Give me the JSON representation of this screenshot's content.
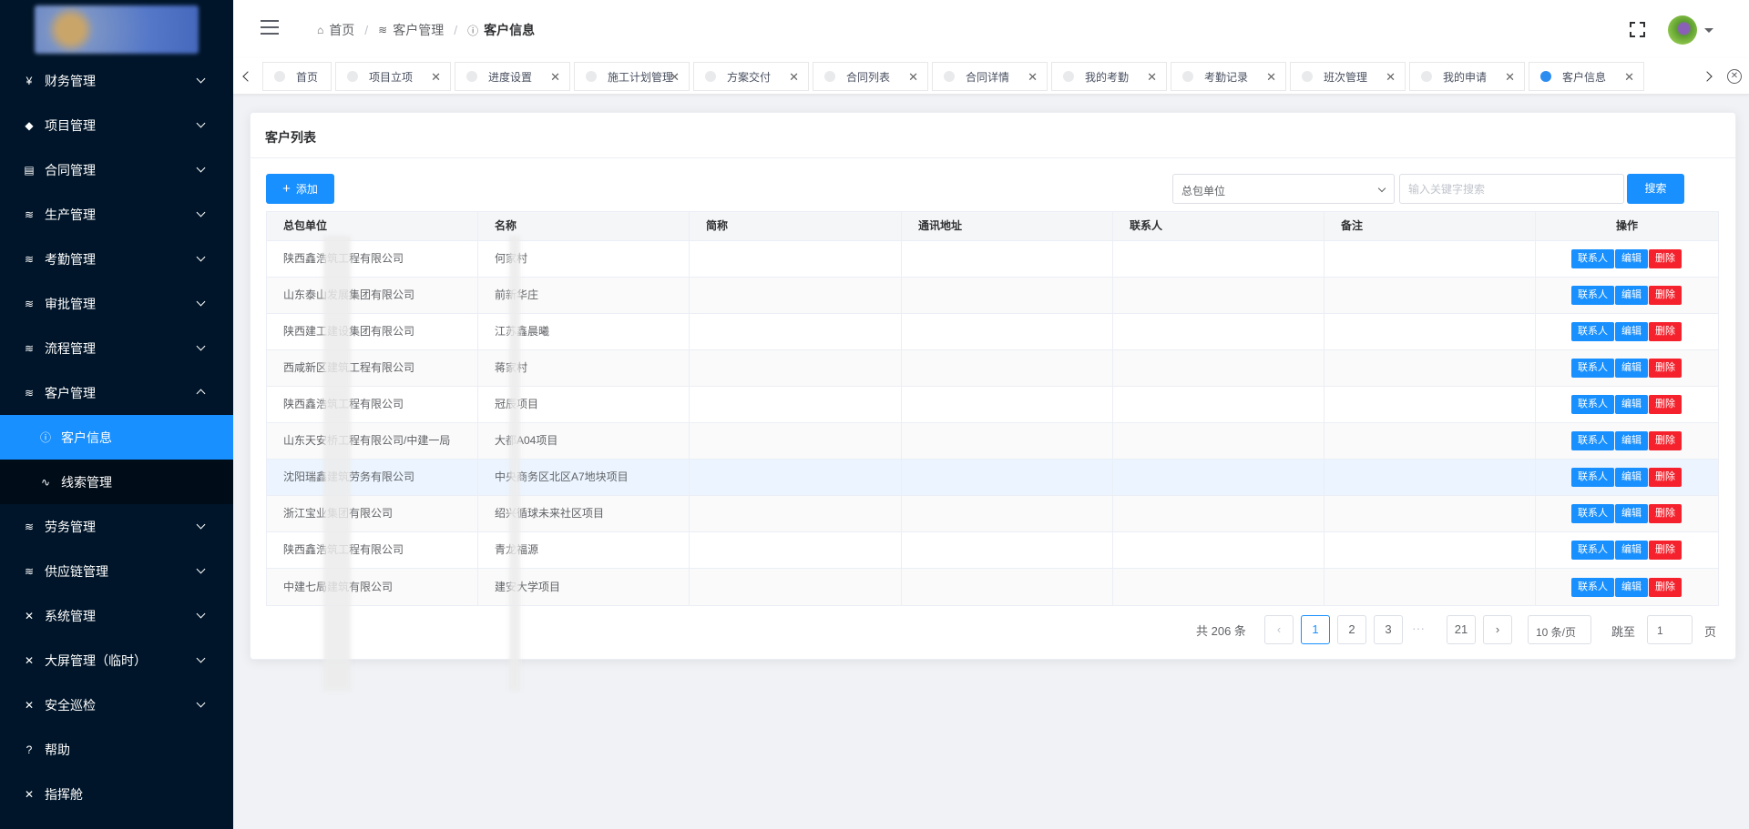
{
  "sidebar": {
    "items": [
      {
        "icon": "¥",
        "label": "财务管理",
        "expanded": false
      },
      {
        "icon": "◆",
        "label": "项目管理",
        "expanded": false
      },
      {
        "icon": "▤",
        "label": "合同管理",
        "expanded": false
      },
      {
        "icon": "≋",
        "label": "生产管理",
        "expanded": false
      },
      {
        "icon": "≋",
        "label": "考勤管理",
        "expanded": false
      },
      {
        "icon": "≋",
        "label": "审批管理",
        "expanded": false
      },
      {
        "icon": "≋",
        "label": "流程管理",
        "expanded": false
      },
      {
        "icon": "≋",
        "label": "客户管理",
        "expanded": true
      },
      {
        "icon": "ⓘ",
        "label": "客户信息",
        "sub": true,
        "active": true
      },
      {
        "icon": "∿",
        "label": "线索管理",
        "sub": true
      },
      {
        "icon": "≋",
        "label": "劳务管理",
        "expanded": false
      },
      {
        "icon": "≋",
        "label": "供应链管理",
        "expanded": false
      },
      {
        "icon": "✕",
        "label": "系统管理",
        "expanded": false
      },
      {
        "icon": "✕",
        "label": "大屏管理（临时）",
        "expanded": false
      },
      {
        "icon": "✕",
        "label": "安全巡检",
        "expanded": false
      },
      {
        "icon": "?",
        "label": "帮助"
      },
      {
        "icon": "✕",
        "label": "指挥舱"
      }
    ]
  },
  "header": {
    "breadcrumb": [
      "首页",
      "客户管理",
      "客户信息"
    ]
  },
  "tags": [
    "首页",
    "项目立项",
    "进度设置",
    "施工计划管理",
    "方案交付",
    "合同列表",
    "合同详情",
    "我的考勤",
    "考勤记录",
    "班次管理",
    "我的申请",
    "客户信息"
  ],
  "card": {
    "title": "客户列表",
    "add_label": "添加",
    "select_value": "总包单位",
    "search_placeholder": "输入关键字搜索",
    "search_label": "搜索"
  },
  "table": {
    "columns": [
      "总包单位",
      "名称",
      "简称",
      "通讯地址",
      "联系人",
      "备注",
      "操作"
    ],
    "rows": [
      {
        "unit": "陕西鑫浩筑工程有限公司",
        "name": "何家村"
      },
      {
        "unit": "山东泰山发展集团有限公司",
        "name": "前新华庄"
      },
      {
        "unit": "陕西建工建设集团有限公司",
        "name": "江苏鑫晨曦"
      },
      {
        "unit": "西咸新区建筑工程有限公司",
        "name": "蒋家村"
      },
      {
        "unit": "陕西鑫浩筑工程有限公司",
        "name": "冠辰项目"
      },
      {
        "unit": "山东天安桥工程有限公司/中建一局",
        "name": "大都A04项目"
      },
      {
        "unit": "沈阳瑞鑫建筑劳务有限公司",
        "name": "中央商务区北区A7地块项目"
      },
      {
        "unit": "浙江宝业集团有限公司",
        "name": "绍兴循球未来社区项目"
      },
      {
        "unit": "陕西鑫浩筑工程有限公司",
        "name": "青龙福源"
      },
      {
        "unit": "中建七局建筑有限公司",
        "name": "建安大学项目"
      }
    ],
    "actions": [
      "联系人",
      "编辑",
      "删除"
    ]
  },
  "pagination": {
    "total_text": "共 206 条",
    "pages": [
      "1",
      "2",
      "3",
      "21"
    ],
    "ellipsis": "···",
    "page_size": "10 条/页",
    "jump_label": "跳至",
    "jump_value": "1",
    "page_word": "页"
  },
  "colors": {
    "sidebar": "#001529",
    "active": "#1890ff",
    "danger": "#f5222d"
  }
}
